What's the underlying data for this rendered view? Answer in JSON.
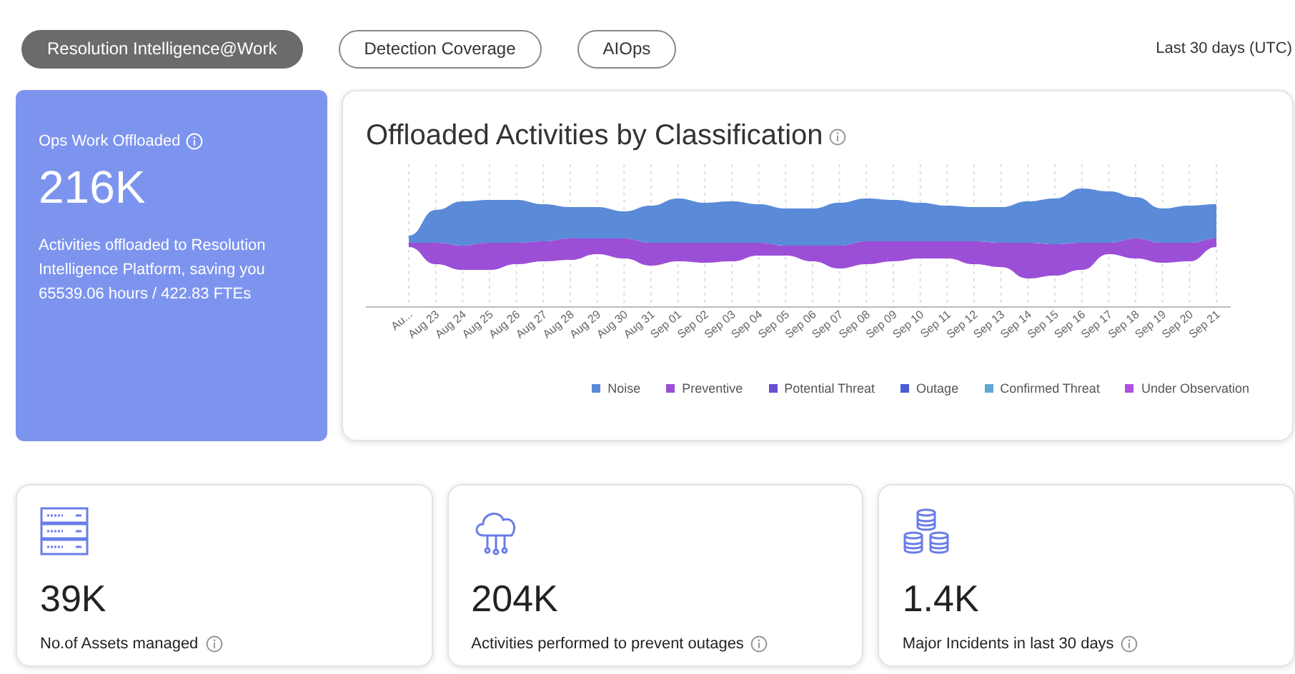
{
  "tabs": [
    {
      "label": "Resolution Intelligence@Work",
      "selected": true
    },
    {
      "label": "Detection Coverage",
      "selected": false
    },
    {
      "label": "AIOps",
      "selected": false
    }
  ],
  "date_range": "Last 30 days (UTC)",
  "summary_card": {
    "title": "Ops Work Offloaded",
    "value": "216K",
    "description": "Activities offloaded to Resolution Intelligence Platform, saving you 65539.06 hours / 422.83 FTEs"
  },
  "chart": {
    "title": "Offloaded Activities by Classification",
    "x_labels": [
      "Au...",
      "Aug 23",
      "Aug 24",
      "Aug 25",
      "Aug 26",
      "Aug 27",
      "Aug 28",
      "Aug 29",
      "Aug 30",
      "Aug 31",
      "Sep 01",
      "Sep 02",
      "Sep 03",
      "Sep 04",
      "Sep 05",
      "Sep 06",
      "Sep 07",
      "Sep 08",
      "Sep 09",
      "Sep 10",
      "Sep 11",
      "Sep 12",
      "Sep 13",
      "Sep 14",
      "Sep 15",
      "Sep 16",
      "Sep 17",
      "Sep 18",
      "Sep 19",
      "Sep 20",
      "Sep 21"
    ],
    "legend": [
      {
        "label": "Noise",
        "color": "#5b8ad8"
      },
      {
        "label": "Preventive",
        "color": "#9b4fd6"
      },
      {
        "label": "Potential Threat",
        "color": "#6a4fd0"
      },
      {
        "label": "Outage",
        "color": "#4a5bd4"
      },
      {
        "label": "Confirmed Threat",
        "color": "#5fa8d8"
      },
      {
        "label": "Under Observation",
        "color": "#b04fe0"
      }
    ]
  },
  "stats": [
    {
      "kind": "servers",
      "value": "39K",
      "label": "No.of Assets managed"
    },
    {
      "kind": "cloud",
      "value": "204K",
      "label": "Activities performed to prevent outages"
    },
    {
      "kind": "databases",
      "value": "1.4K",
      "label": "Major Incidents in last 30 days"
    }
  ]
}
